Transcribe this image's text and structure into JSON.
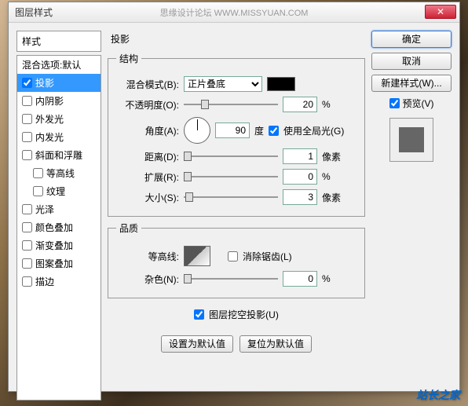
{
  "title": "图层样式",
  "watermark": "思缘设计论坛  WWW.MISSYUAN.COM",
  "sidebar": {
    "header": "样式",
    "items": [
      {
        "label": "混合选项:默认",
        "checked": null
      },
      {
        "label": "投影",
        "checked": true,
        "selected": true
      },
      {
        "label": "内阴影",
        "checked": false
      },
      {
        "label": "外发光",
        "checked": false
      },
      {
        "label": "内发光",
        "checked": false
      },
      {
        "label": "斜面和浮雕",
        "checked": false
      },
      {
        "label": "等高线",
        "checked": false,
        "sub": true
      },
      {
        "label": "纹理",
        "checked": false,
        "sub": true
      },
      {
        "label": "光泽",
        "checked": false
      },
      {
        "label": "颜色叠加",
        "checked": false
      },
      {
        "label": "渐变叠加",
        "checked": false
      },
      {
        "label": "图案叠加",
        "checked": false
      },
      {
        "label": "描边",
        "checked": false
      }
    ]
  },
  "main": {
    "title": "投影",
    "structure": {
      "legend": "结构",
      "blend_label": "混合模式(B):",
      "blend_value": "正片叠底",
      "opacity_label": "不透明度(O):",
      "opacity_value": "20",
      "opacity_unit": "%",
      "angle_label": "角度(A):",
      "angle_value": "90",
      "angle_unit": "度",
      "global_light_label": "使用全局光(G)",
      "global_light_checked": true,
      "distance_label": "距离(D):",
      "distance_value": "1",
      "distance_unit": "像素",
      "spread_label": "扩展(R):",
      "spread_value": "0",
      "spread_unit": "%",
      "size_label": "大小(S):",
      "size_value": "3",
      "size_unit": "像素"
    },
    "quality": {
      "legend": "品质",
      "contour_label": "等高线:",
      "antialias_label": "消除锯齿(L)",
      "antialias_checked": false,
      "noise_label": "杂色(N):",
      "noise_value": "0",
      "noise_unit": "%"
    },
    "knockout_label": "图层挖空投影(U)",
    "knockout_checked": true,
    "make_default_btn": "设置为默认值",
    "reset_default_btn": "复位为默认值"
  },
  "buttons": {
    "ok": "确定",
    "cancel": "取消",
    "new_style": "新建样式(W)...",
    "preview_label": "预览(V)",
    "preview_checked": true
  },
  "footer": "站长之家"
}
